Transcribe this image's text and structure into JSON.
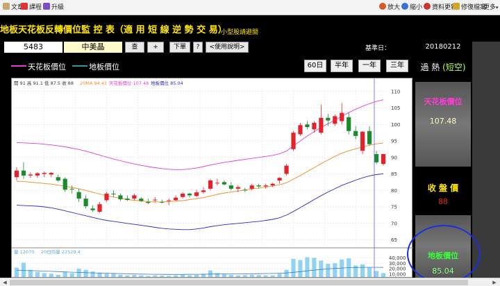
{
  "toolbar": {
    "left_items": [
      {
        "label": "文章",
        "icon": "document-icon"
      },
      {
        "label": "課程",
        "icon": "course-icon"
      },
      {
        "label": "升級",
        "icon": "upgrade-icon"
      }
    ],
    "right_items": [
      {
        "label": "放大",
        "icon": "zoom-in-icon"
      },
      {
        "label": "縮小",
        "icon": "zoom-out-icon"
      },
      {
        "label": "資料更新",
        "icon": "refresh-icon"
      },
      {
        "label": "修復檔案",
        "icon": "repair-icon"
      },
      {
        "label": "更多",
        "icon": "more-icon"
      }
    ]
  },
  "title": {
    "main": "地板天花板反轉價位監 控 表（適 用 短 線 逆 勢 交 易）",
    "sub": "小型股請避開"
  },
  "input_row": {
    "code": "5483",
    "name": "中美晶",
    "query_button": "查",
    "plus_button": "+",
    "order_button": "下單",
    "help_q_button": "?",
    "manual_button": "<使用說明>",
    "base_date_label": "基準日：",
    "base_date_value": "20180212"
  },
  "legend": {
    "ceiling": "天花板價位",
    "floor": "地板價位",
    "ceiling_color": "#e83ad8",
    "floor_color": "#2e6bb8"
  },
  "range_buttons": [
    "60日",
    "半年",
    "一年",
    "三年"
  ],
  "chart_header": {
    "ohlc_text": "開 91  高 91.1  低 87.5  收 88",
    "ma_text": "20MA 94.41",
    "ceiling_text": "天花板價位 107.48",
    "floor_text": "地板價位 85.04"
  },
  "volume_header": {
    "vol_text": "量 12070",
    "avg_text": "20日均量 22529.4"
  },
  "info_panel": {
    "status_main": "過 熱",
    "status_paren": "(短空)",
    "ceiling_label": "天花板價位",
    "ceiling_value": "107.48",
    "close_label": "收 盤 價",
    "close_value": "88",
    "floor_label": "地板價位",
    "floor_value": "85.04"
  },
  "colors": {
    "up": "#e8202a",
    "down": "#1a8a2a",
    "ma": "#f08a20",
    "ceiling": "#e83ad8",
    "floor": "#2a2ac8",
    "volume": "#8fd3f4",
    "accent_yellow": "#ffe600"
  },
  "chart_data": {
    "type": "candlestick",
    "y_ticks": [
      65,
      70,
      75,
      80,
      85,
      90,
      95,
      100,
      105,
      110
    ],
    "ylim": [
      63,
      111
    ],
    "candles": [
      [
        84,
        87,
        83,
        86
      ],
      [
        86,
        88.5,
        83.5,
        84.5
      ],
      [
        84.5,
        85.5,
        83.8,
        84.8
      ],
      [
        84.5,
        85.5,
        83.8,
        85.2
      ],
      [
        85,
        85.8,
        84,
        85.3
      ],
      [
        84.8,
        85.6,
        84,
        85.3
      ],
      [
        84,
        84.8,
        82.5,
        83
      ],
      [
        83.5,
        84,
        79.5,
        80.2
      ],
      [
        80.5,
        81.5,
        79,
        80.4
      ],
      [
        79.5,
        80.5,
        76.5,
        77.5
      ],
      [
        77.5,
        78.5,
        74.5,
        75.2
      ],
      [
        74.5,
        75.5,
        73.5,
        74
      ],
      [
        73.5,
        76.5,
        73.2,
        75.8
      ],
      [
        77,
        79.5,
        76.5,
        79
      ],
      [
        79,
        80,
        78,
        78.8
      ],
      [
        78.5,
        79,
        76.8,
        77.3
      ],
      [
        77.5,
        78.5,
        76.8,
        77.1
      ],
      [
        77.5,
        79,
        77,
        78.5
      ],
      [
        77.5,
        78,
        76.5,
        76.8
      ],
      [
        76.5,
        77.5,
        75.8,
        76.2
      ],
      [
        77,
        78,
        76.3,
        77.2
      ],
      [
        76.5,
        77.2,
        76,
        76.3
      ],
      [
        76.8,
        77.5,
        75.5,
        77
      ],
      [
        77,
        78.5,
        76.8,
        77.8
      ],
      [
        78,
        79.5,
        77.5,
        79
      ],
      [
        79,
        79.3,
        77.8,
        78.5
      ],
      [
        78.3,
        80.2,
        78,
        79.4
      ],
      [
        79.5,
        81,
        79,
        80
      ],
      [
        80.5,
        83.5,
        80,
        83
      ],
      [
        82.3,
        83.5,
        81.5,
        82.3
      ],
      [
        82.5,
        83,
        81.5,
        81.8
      ],
      [
        81.5,
        82.5,
        80,
        80.5
      ],
      [
        80.5,
        81.5,
        79.5,
        81
      ],
      [
        80.2,
        80.8,
        79.5,
        80
      ],
      [
        80.5,
        82,
        80,
        81.5
      ],
      [
        81.5,
        82,
        80.5,
        81.2
      ],
      [
        81.2,
        82,
        80.5,
        81.5
      ],
      [
        81.5,
        82.3,
        81,
        82
      ],
      [
        83,
        84,
        82,
        83.8
      ],
      [
        85,
        88,
        84.5,
        87.5
      ],
      [
        92.5,
        98,
        92,
        97.5
      ],
      [
        97,
        100.5,
        96.5,
        99.8
      ],
      [
        100,
        101,
        98.5,
        99.2
      ],
      [
        98.5,
        101,
        97.5,
        100.5
      ],
      [
        97.5,
        106,
        97,
        102
      ],
      [
        102,
        103.2,
        99.5,
        101.2
      ],
      [
        100.2,
        103,
        99.5,
        102.5
      ],
      [
        101,
        106.5,
        100,
        103.5
      ],
      [
        102.2,
        103.5,
        97,
        98
      ],
      [
        98,
        99.5,
        95.5,
        96.5
      ],
      [
        92,
        98,
        91,
        97.8
      ],
      [
        98,
        99.5,
        93.5,
        94
      ],
      [
        91,
        92,
        88,
        88.5
      ],
      [
        88,
        91.1,
        87.5,
        91
      ]
    ],
    "ma20": [
      82.8,
      82.7,
      82.5,
      82.3,
      82.1,
      81.9,
      81.6,
      81.3,
      80.9,
      80.5,
      80.0,
      79.4,
      78.9,
      78.4,
      78.0,
      77.6,
      77.2,
      77.0,
      76.8,
      76.6,
      76.5,
      76.5,
      76.6,
      76.7,
      76.9,
      77.2,
      77.5,
      77.8,
      78.3,
      78.8,
      79.2,
      79.5,
      79.8,
      80.1,
      80.4,
      80.7,
      81.0,
      81.3,
      81.7,
      82.3,
      83.4,
      84.5,
      85.7,
      86.9,
      88.1,
      89.2,
      90.3,
      91.3,
      92.0,
      92.6,
      93.2,
      93.7,
      94.1,
      94.41
    ],
    "ceiling": [
      94.5,
      94.4,
      94.3,
      94.2,
      94.0,
      93.8,
      93.5,
      93.2,
      92.8,
      92.4,
      91.9,
      91.3,
      90.7,
      90.1,
      89.5,
      89.0,
      88.5,
      88.0,
      87.6,
      87.2,
      86.9,
      86.6,
      86.4,
      86.3,
      86.3,
      86.5,
      86.8,
      87.2,
      87.7,
      88.1,
      88.5,
      88.8,
      89.1,
      89.4,
      89.7,
      90.0,
      90.3,
      90.6,
      91.1,
      91.9,
      93.5,
      95.0,
      96.5,
      97.8,
      99.1,
      100.2,
      101.3,
      102.5,
      103.6,
      104.6,
      105.5,
      106.3,
      107.0,
      107.48
    ],
    "floor": [
      75.5,
      75.4,
      75.3,
      75.2,
      75.0,
      74.7,
      74.3,
      73.8,
      73.3,
      72.8,
      72.3,
      71.8,
      71.3,
      70.9,
      70.6,
      70.3,
      70.0,
      69.7,
      69.4,
      69.1,
      68.8,
      68.5,
      68.3,
      68.2,
      68.1,
      68.1,
      68.3,
      68.6,
      69.0,
      69.3,
      69.6,
      69.8,
      70.0,
      70.2,
      70.4,
      70.6,
      70.9,
      71.2,
      71.7,
      72.5,
      73.6,
      74.8,
      76.0,
      77.2,
      78.4,
      79.5,
      80.5,
      81.5,
      82.3,
      83.1,
      83.8,
      84.4,
      84.8,
      85.04
    ],
    "volume_ticks": [
      10000,
      20000,
      30000,
      40000
    ],
    "volume_ylim": [
      5000,
      43000
    ],
    "volume": [
      22000,
      31000,
      18000,
      14000,
      12000,
      11000,
      9000,
      14000,
      12000,
      20000,
      18000,
      15000,
      13000,
      11000,
      12000,
      9000,
      8000,
      9000,
      8000,
      7000,
      8000,
      7500,
      7000,
      8000,
      9000,
      8000,
      9000,
      11000,
      17000,
      12000,
      10000,
      9000,
      8000,
      8500,
      9000,
      8500,
      8000,
      8000,
      11000,
      18000,
      38000,
      36000,
      41000,
      40000,
      35000,
      29000,
      30000,
      37000,
      39000,
      26000,
      28000,
      22000,
      16000,
      12070
    ],
    "volume_avg": [
      17000,
      16800,
      16500,
      16200,
      15800,
      15300,
      14800,
      14300,
      13800,
      13300,
      12900,
      12500,
      12100,
      11800,
      11500,
      11200,
      10900,
      10600,
      10300,
      10100,
      9900,
      9800,
      9700,
      9700,
      9700,
      9800,
      9900,
      10000,
      10300,
      10500,
      10600,
      10700,
      10800,
      10900,
      11000,
      11100,
      11300,
      11500,
      11800,
      12300,
      13500,
      14800,
      16200,
      17500,
      18700,
      19700,
      20600,
      21400,
      22000,
      22400,
      22600,
      22700,
      22600,
      22529.4
    ]
  }
}
